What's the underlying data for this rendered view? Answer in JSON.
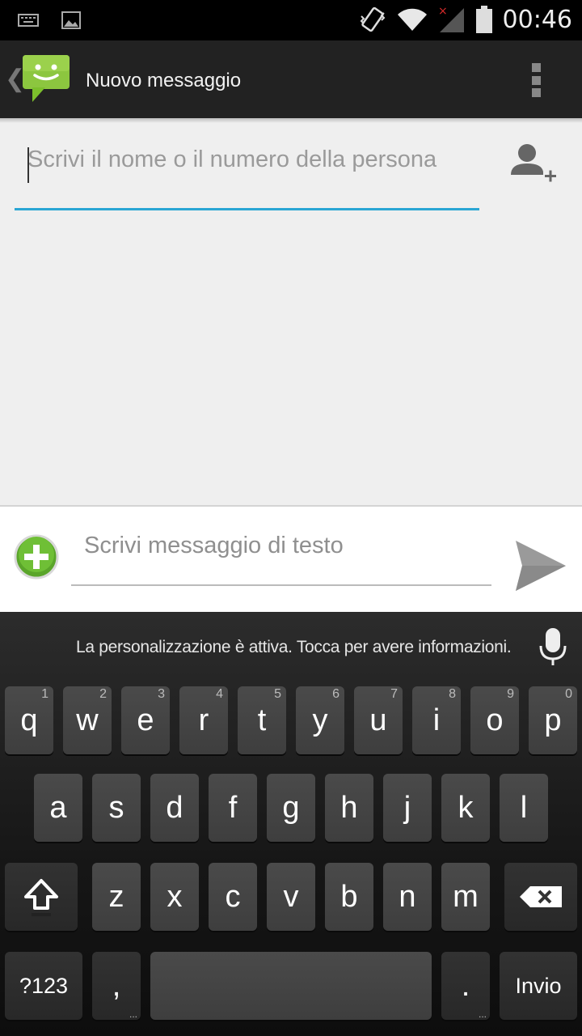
{
  "status_bar": {
    "time": "00:46",
    "icons": [
      "keyboard-icon",
      "image-icon",
      "vibrate-icon",
      "wifi-icon",
      "signal-icon",
      "battery-icon"
    ]
  },
  "action_bar": {
    "title": "Nuovo messaggio",
    "up_glyph": "❮",
    "app_icon": "messaging-icon",
    "overflow_icon": "overflow-menu-icon"
  },
  "recipient": {
    "placeholder": "Scrivi il nome o il numero della persona",
    "add_contact_icon": "add-contact-icon"
  },
  "compose": {
    "placeholder": "Scrivi messaggio di testo",
    "attach_icon": "attach-plus-icon",
    "send_icon": "send-icon"
  },
  "keyboard": {
    "suggestion_text": "La personalizzazione è attiva. Tocca per avere informazioni.",
    "mic_icon": "microphone-icon",
    "row1": [
      {
        "label": "q",
        "hint": "1"
      },
      {
        "label": "w",
        "hint": "2"
      },
      {
        "label": "e",
        "hint": "3"
      },
      {
        "label": "r",
        "hint": "4"
      },
      {
        "label": "t",
        "hint": "5"
      },
      {
        "label": "y",
        "hint": "6"
      },
      {
        "label": "u",
        "hint": "7"
      },
      {
        "label": "i",
        "hint": "8"
      },
      {
        "label": "o",
        "hint": "9"
      },
      {
        "label": "p",
        "hint": "0"
      }
    ],
    "row2": [
      "a",
      "s",
      "d",
      "f",
      "g",
      "h",
      "j",
      "k",
      "l"
    ],
    "row3": [
      "z",
      "x",
      "c",
      "v",
      "b",
      "n",
      "m"
    ],
    "shift_icon": "shift-icon",
    "backspace_icon": "backspace-icon",
    "symbols_label": "?123",
    "comma_label": ",",
    "period_label": ".",
    "enter_label": "Invio"
  },
  "colors": {
    "accent": "#2aa6d4",
    "app_green": "#7cbf2c"
  }
}
